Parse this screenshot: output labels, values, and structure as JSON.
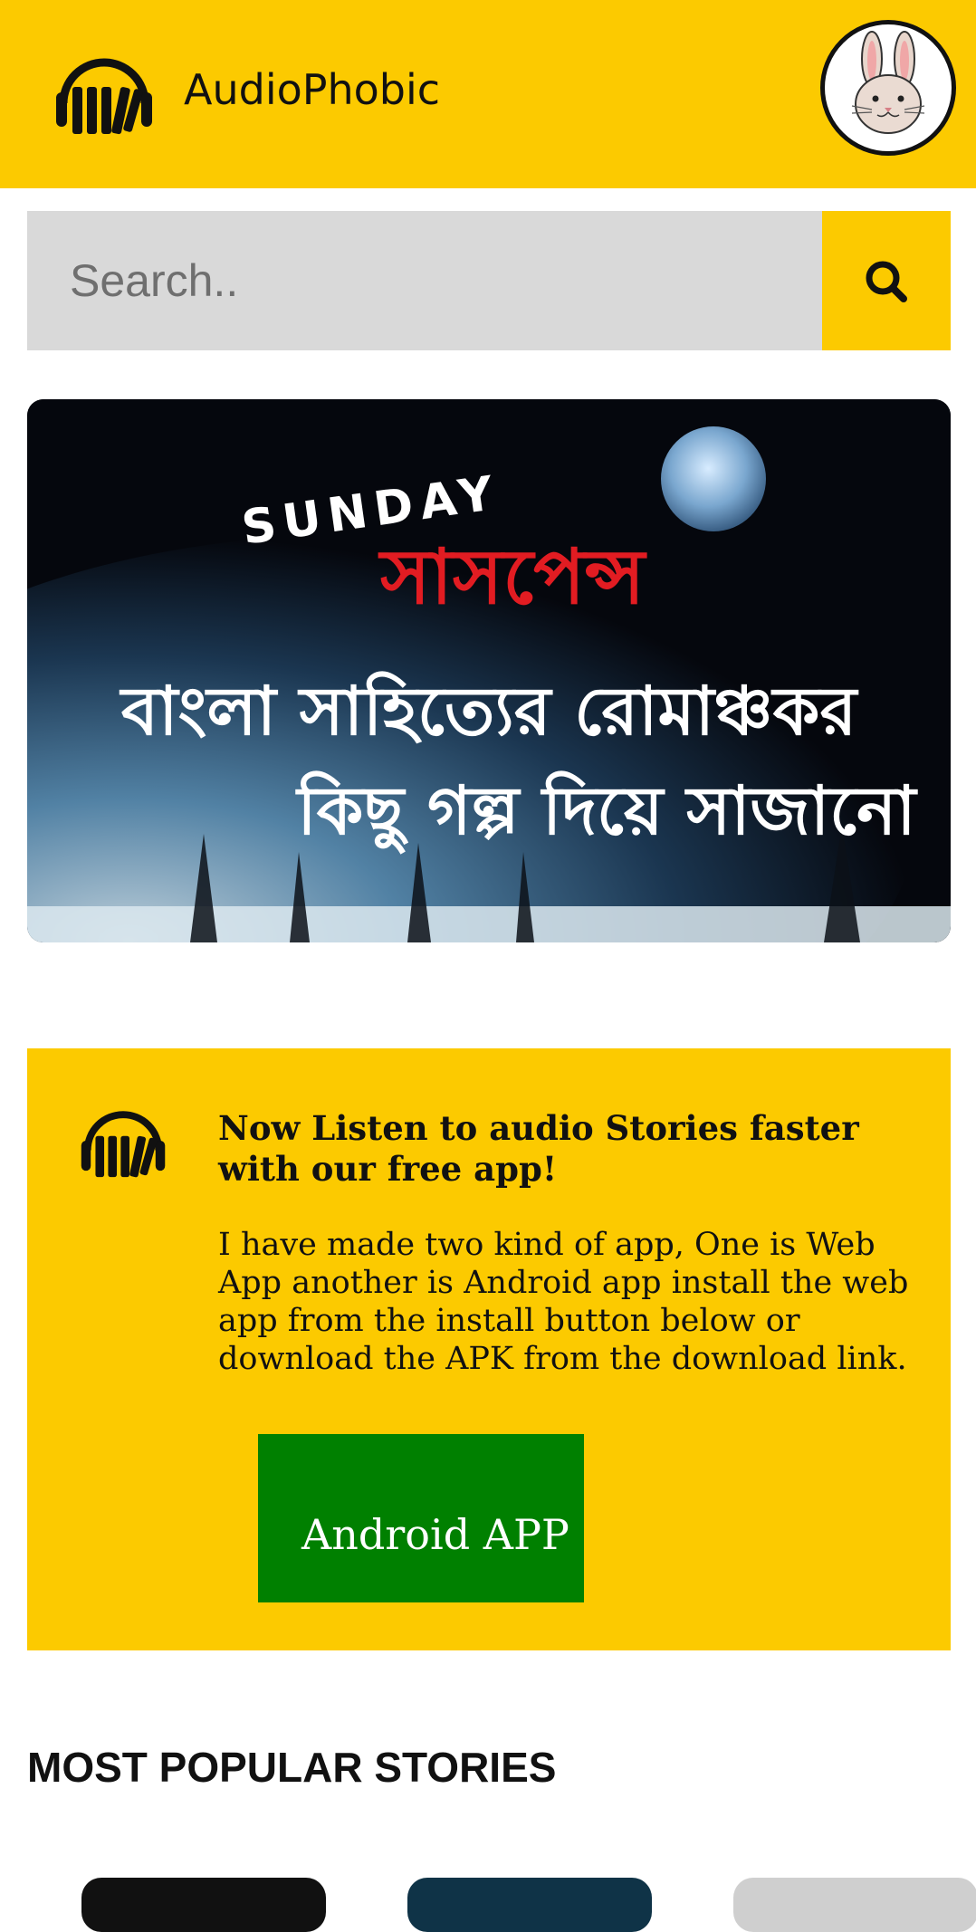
{
  "header": {
    "brand": "AudioPhobic",
    "logo_icon": "headphones-icon",
    "avatar_icon": "rabbit-avatar",
    "bg_color": "#fcca00"
  },
  "search": {
    "placeholder": "Search..",
    "button_icon": "search-icon"
  },
  "banner": {
    "line_sunday": "SUNDAY",
    "line_suspense": "সাসপেন্স",
    "line_1": "বাংলা সাহিত্যের রোমাঞ্চকর",
    "line_2": "কিছু গল্প দিয়ে সাজানো"
  },
  "promo": {
    "icon": "headphones-icon",
    "title": "Now Listen to audio Stories faster with our free app!",
    "text": "I have made two kind of app, One is Web App another is Android app install the web app from the install button below or download the APK from the download link.",
    "button_label": "Android APP",
    "button_color": "#008000"
  },
  "popular": {
    "title": "MOST POPULAR STORIES"
  }
}
